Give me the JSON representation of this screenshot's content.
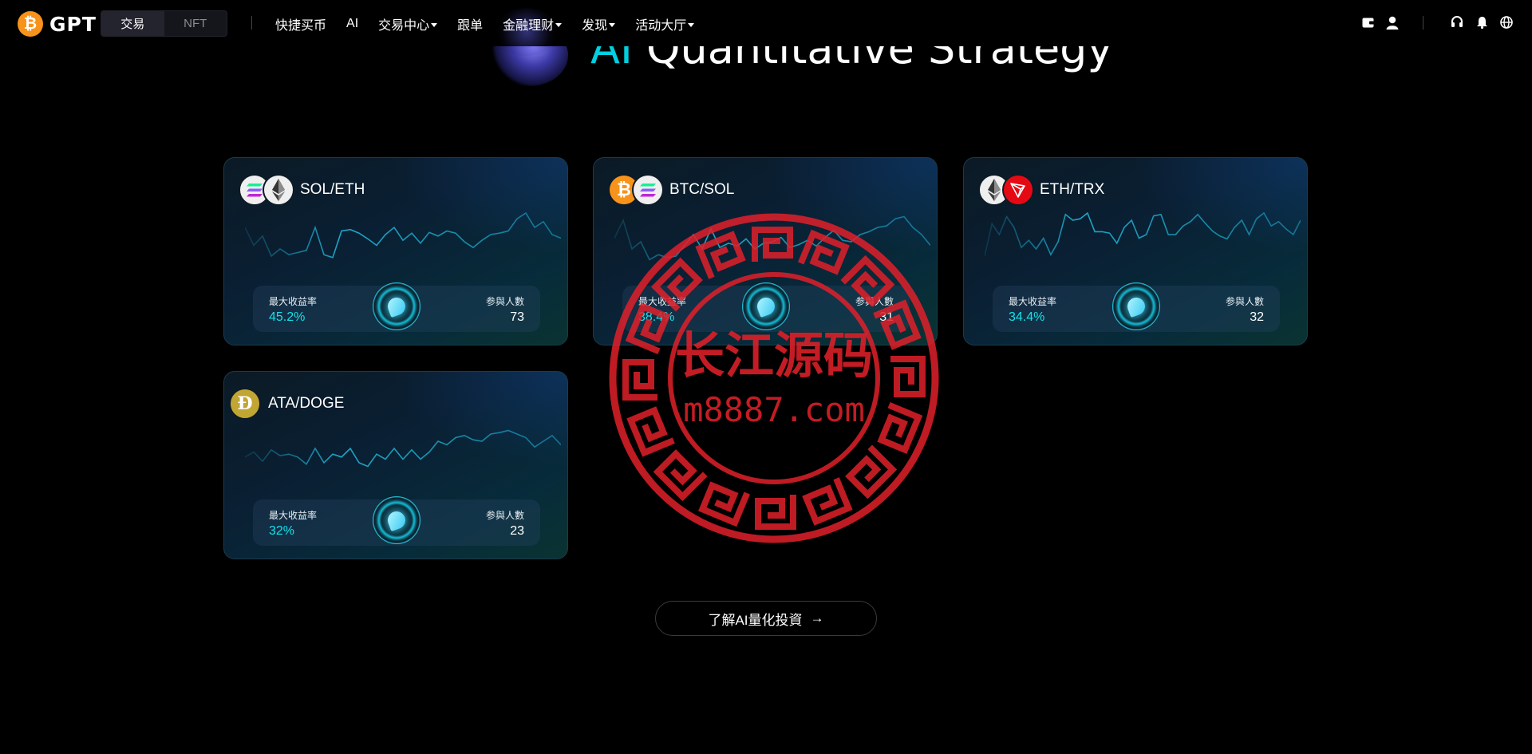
{
  "nav": {
    "brand": "GPT",
    "segment": {
      "trade": "交易",
      "nft": "NFT"
    },
    "items": [
      {
        "label": "快捷买币",
        "has_caret": false
      },
      {
        "label": "AI",
        "has_caret": false
      },
      {
        "label": "交易中心",
        "has_caret": true
      },
      {
        "label": "跟单",
        "has_caret": false
      },
      {
        "label": "金融理财",
        "has_caret": true
      },
      {
        "label": "发现",
        "has_caret": true
      },
      {
        "label": "活动大厅",
        "has_caret": true
      }
    ],
    "right_icons": [
      "wallet-icon",
      "user-icon",
      "headset-icon",
      "bell-icon",
      "globe-icon"
    ]
  },
  "hero": {
    "ai": "AI",
    "rest": " Quantitative Strategy"
  },
  "cards": [
    {
      "pair": "SOL/ETH",
      "coins": [
        "SOL",
        "ETH"
      ],
      "max_yield_label": "最大收益率",
      "max_yield": "45.2%",
      "participants_label": "参與人數",
      "participants": "73"
    },
    {
      "pair": "BTC/SOL",
      "coins": [
        "BTC",
        "SOL"
      ],
      "max_yield_label": "最大收益率",
      "max_yield": "38.4%",
      "participants_label": "参與人數",
      "participants": "31"
    },
    {
      "pair": "ETH/TRX",
      "coins": [
        "ETH",
        "TRX"
      ],
      "max_yield_label": "最大收益率",
      "max_yield": "34.4%",
      "participants_label": "参與人數",
      "participants": "32"
    },
    {
      "pair": "ATA/DOGE",
      "coins": [
        "DOGE"
      ],
      "max_yield_label": "最大收益率",
      "max_yield": "32%",
      "participants_label": "参與人數",
      "participants": "23"
    }
  ],
  "sparklines": [
    [
      30,
      55,
      42,
      70,
      60,
      68,
      65,
      62,
      30,
      68,
      72,
      35,
      33,
      38,
      46,
      55,
      40,
      30,
      48,
      38,
      52,
      37,
      42,
      35,
      38,
      50,
      58,
      48,
      40,
      38,
      35,
      18,
      10,
      30,
      22,
      40,
      45
    ],
    [
      45,
      20,
      60,
      50,
      75,
      68,
      72,
      70,
      55,
      40,
      60,
      32,
      58,
      52,
      56,
      46,
      60,
      52,
      50,
      44,
      58,
      54,
      48,
      56,
      44,
      34,
      48,
      50,
      40,
      36,
      30,
      28,
      18,
      15,
      30,
      40,
      55
    ],
    [
      70,
      25,
      40,
      15,
      30,
      58,
      48,
      60,
      45,
      68,
      50,
      12,
      20,
      18,
      10,
      36,
      36,
      38,
      52,
      30,
      20,
      45,
      40,
      14,
      12,
      40,
      40,
      28,
      22,
      12,
      24,
      35,
      42,
      46,
      30,
      20,
      40,
      18,
      10,
      28,
      22,
      32,
      40,
      20
    ],
    [
      52,
      45,
      58,
      42,
      50,
      48,
      52,
      62,
      40,
      60,
      48,
      52,
      40,
      60,
      65,
      48,
      55,
      40,
      55,
      42,
      55,
      45,
      30,
      35,
      25,
      22,
      28,
      30,
      20,
      18,
      15,
      20,
      25,
      38,
      30,
      22,
      35
    ]
  ],
  "cta": {
    "label": "了解AI量化投資",
    "arrow": "→"
  },
  "watermark": {
    "text": "长江源码",
    "url": "m8887.com"
  },
  "colors": {
    "accent": "#14e3ea",
    "spark": "#1fb6d9",
    "watermark": "#e0202a",
    "btc": "#f7931a",
    "trx": "#e50914",
    "doge": "#c2a633"
  }
}
